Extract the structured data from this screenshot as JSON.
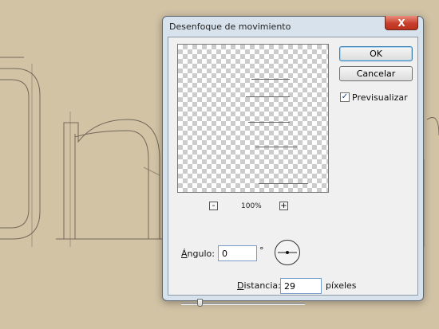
{
  "dialog": {
    "title": "Desenfoque de movimiento",
    "close_label": "X"
  },
  "preview": {
    "zoom": "100%",
    "zoom_out_label": "-",
    "zoom_in_label": "+"
  },
  "buttons": {
    "ok": "OK",
    "cancel": "Cancelar"
  },
  "preview_checkbox": {
    "label": "Previsualizar",
    "checked": true
  },
  "angle": {
    "label_before": "Á",
    "label_after": "ngulo:",
    "value": "0",
    "unit": "°"
  },
  "distance": {
    "label_before": "D",
    "label_after": "istancia:",
    "value": "29",
    "unit": "píxeles"
  },
  "slider": {
    "fraction": 0.15
  },
  "colors": {
    "background": "#d2c3a5",
    "dialog_frame": "#d8e2ec",
    "close_button": "#c8402d"
  }
}
